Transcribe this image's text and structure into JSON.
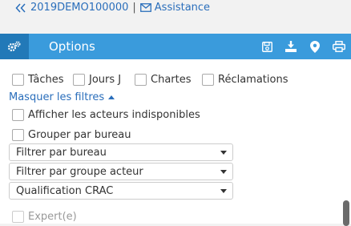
{
  "topbar": {
    "demo_link": "2019DEMO100000",
    "separator": "|",
    "assistance_link": "Assistance"
  },
  "panel": {
    "title": "Options",
    "header_icons": [
      "save-icon",
      "download-icon",
      "map-marker-icon",
      "print-icon"
    ]
  },
  "categories": [
    {
      "label": "Tâches"
    },
    {
      "label": "Jours J"
    },
    {
      "label": "Chartes"
    },
    {
      "label": "Réclamations"
    }
  ],
  "filters_toggle": "Masquer les filtres",
  "options": {
    "unavailable_actors": "Afficher les acteurs indisponibles",
    "group_by_office": "Grouper par bureau"
  },
  "selects": {
    "office": "Filtrer par bureau",
    "actor_group": "Filtrer par groupe acteur",
    "qualification": "Qualification CRAC"
  },
  "expert_label": "Expert(e)",
  "colors": {
    "header": "#3a9bdc",
    "header_dark": "#2279b8",
    "link": "#2a6ebb"
  }
}
